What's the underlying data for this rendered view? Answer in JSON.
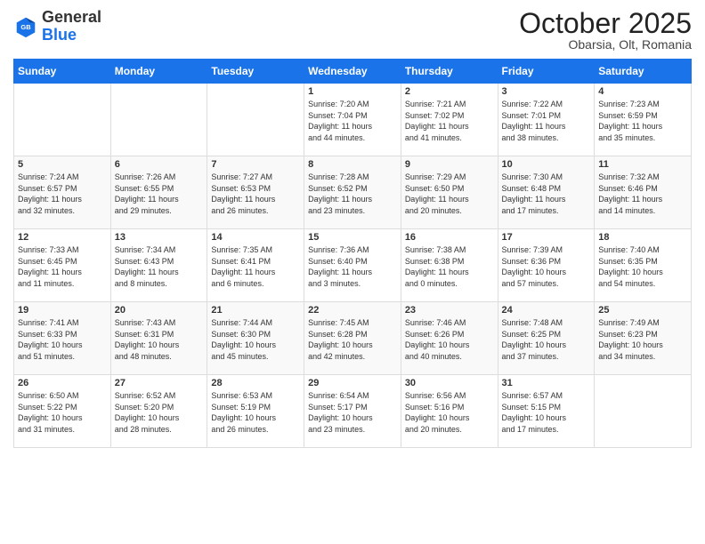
{
  "header": {
    "logo_general": "General",
    "logo_blue": "Blue",
    "month_title": "October 2025",
    "subtitle": "Obarsia, Olt, Romania"
  },
  "weekdays": [
    "Sunday",
    "Monday",
    "Tuesday",
    "Wednesday",
    "Thursday",
    "Friday",
    "Saturday"
  ],
  "weeks": [
    [
      {
        "day": "",
        "info": ""
      },
      {
        "day": "",
        "info": ""
      },
      {
        "day": "",
        "info": ""
      },
      {
        "day": "1",
        "info": "Sunrise: 7:20 AM\nSunset: 7:04 PM\nDaylight: 11 hours\nand 44 minutes."
      },
      {
        "day": "2",
        "info": "Sunrise: 7:21 AM\nSunset: 7:02 PM\nDaylight: 11 hours\nand 41 minutes."
      },
      {
        "day": "3",
        "info": "Sunrise: 7:22 AM\nSunset: 7:01 PM\nDaylight: 11 hours\nand 38 minutes."
      },
      {
        "day": "4",
        "info": "Sunrise: 7:23 AM\nSunset: 6:59 PM\nDaylight: 11 hours\nand 35 minutes."
      }
    ],
    [
      {
        "day": "5",
        "info": "Sunrise: 7:24 AM\nSunset: 6:57 PM\nDaylight: 11 hours\nand 32 minutes."
      },
      {
        "day": "6",
        "info": "Sunrise: 7:26 AM\nSunset: 6:55 PM\nDaylight: 11 hours\nand 29 minutes."
      },
      {
        "day": "7",
        "info": "Sunrise: 7:27 AM\nSunset: 6:53 PM\nDaylight: 11 hours\nand 26 minutes."
      },
      {
        "day": "8",
        "info": "Sunrise: 7:28 AM\nSunset: 6:52 PM\nDaylight: 11 hours\nand 23 minutes."
      },
      {
        "day": "9",
        "info": "Sunrise: 7:29 AM\nSunset: 6:50 PM\nDaylight: 11 hours\nand 20 minutes."
      },
      {
        "day": "10",
        "info": "Sunrise: 7:30 AM\nSunset: 6:48 PM\nDaylight: 11 hours\nand 17 minutes."
      },
      {
        "day": "11",
        "info": "Sunrise: 7:32 AM\nSunset: 6:46 PM\nDaylight: 11 hours\nand 14 minutes."
      }
    ],
    [
      {
        "day": "12",
        "info": "Sunrise: 7:33 AM\nSunset: 6:45 PM\nDaylight: 11 hours\nand 11 minutes."
      },
      {
        "day": "13",
        "info": "Sunrise: 7:34 AM\nSunset: 6:43 PM\nDaylight: 11 hours\nand 8 minutes."
      },
      {
        "day": "14",
        "info": "Sunrise: 7:35 AM\nSunset: 6:41 PM\nDaylight: 11 hours\nand 6 minutes."
      },
      {
        "day": "15",
        "info": "Sunrise: 7:36 AM\nSunset: 6:40 PM\nDaylight: 11 hours\nand 3 minutes."
      },
      {
        "day": "16",
        "info": "Sunrise: 7:38 AM\nSunset: 6:38 PM\nDaylight: 11 hours\nand 0 minutes."
      },
      {
        "day": "17",
        "info": "Sunrise: 7:39 AM\nSunset: 6:36 PM\nDaylight: 10 hours\nand 57 minutes."
      },
      {
        "day": "18",
        "info": "Sunrise: 7:40 AM\nSunset: 6:35 PM\nDaylight: 10 hours\nand 54 minutes."
      }
    ],
    [
      {
        "day": "19",
        "info": "Sunrise: 7:41 AM\nSunset: 6:33 PM\nDaylight: 10 hours\nand 51 minutes."
      },
      {
        "day": "20",
        "info": "Sunrise: 7:43 AM\nSunset: 6:31 PM\nDaylight: 10 hours\nand 48 minutes."
      },
      {
        "day": "21",
        "info": "Sunrise: 7:44 AM\nSunset: 6:30 PM\nDaylight: 10 hours\nand 45 minutes."
      },
      {
        "day": "22",
        "info": "Sunrise: 7:45 AM\nSunset: 6:28 PM\nDaylight: 10 hours\nand 42 minutes."
      },
      {
        "day": "23",
        "info": "Sunrise: 7:46 AM\nSunset: 6:26 PM\nDaylight: 10 hours\nand 40 minutes."
      },
      {
        "day": "24",
        "info": "Sunrise: 7:48 AM\nSunset: 6:25 PM\nDaylight: 10 hours\nand 37 minutes."
      },
      {
        "day": "25",
        "info": "Sunrise: 7:49 AM\nSunset: 6:23 PM\nDaylight: 10 hours\nand 34 minutes."
      }
    ],
    [
      {
        "day": "26",
        "info": "Sunrise: 6:50 AM\nSunset: 5:22 PM\nDaylight: 10 hours\nand 31 minutes."
      },
      {
        "day": "27",
        "info": "Sunrise: 6:52 AM\nSunset: 5:20 PM\nDaylight: 10 hours\nand 28 minutes."
      },
      {
        "day": "28",
        "info": "Sunrise: 6:53 AM\nSunset: 5:19 PM\nDaylight: 10 hours\nand 26 minutes."
      },
      {
        "day": "29",
        "info": "Sunrise: 6:54 AM\nSunset: 5:17 PM\nDaylight: 10 hours\nand 23 minutes."
      },
      {
        "day": "30",
        "info": "Sunrise: 6:56 AM\nSunset: 5:16 PM\nDaylight: 10 hours\nand 20 minutes."
      },
      {
        "day": "31",
        "info": "Sunrise: 6:57 AM\nSunset: 5:15 PM\nDaylight: 10 hours\nand 17 minutes."
      },
      {
        "day": "",
        "info": ""
      }
    ]
  ]
}
